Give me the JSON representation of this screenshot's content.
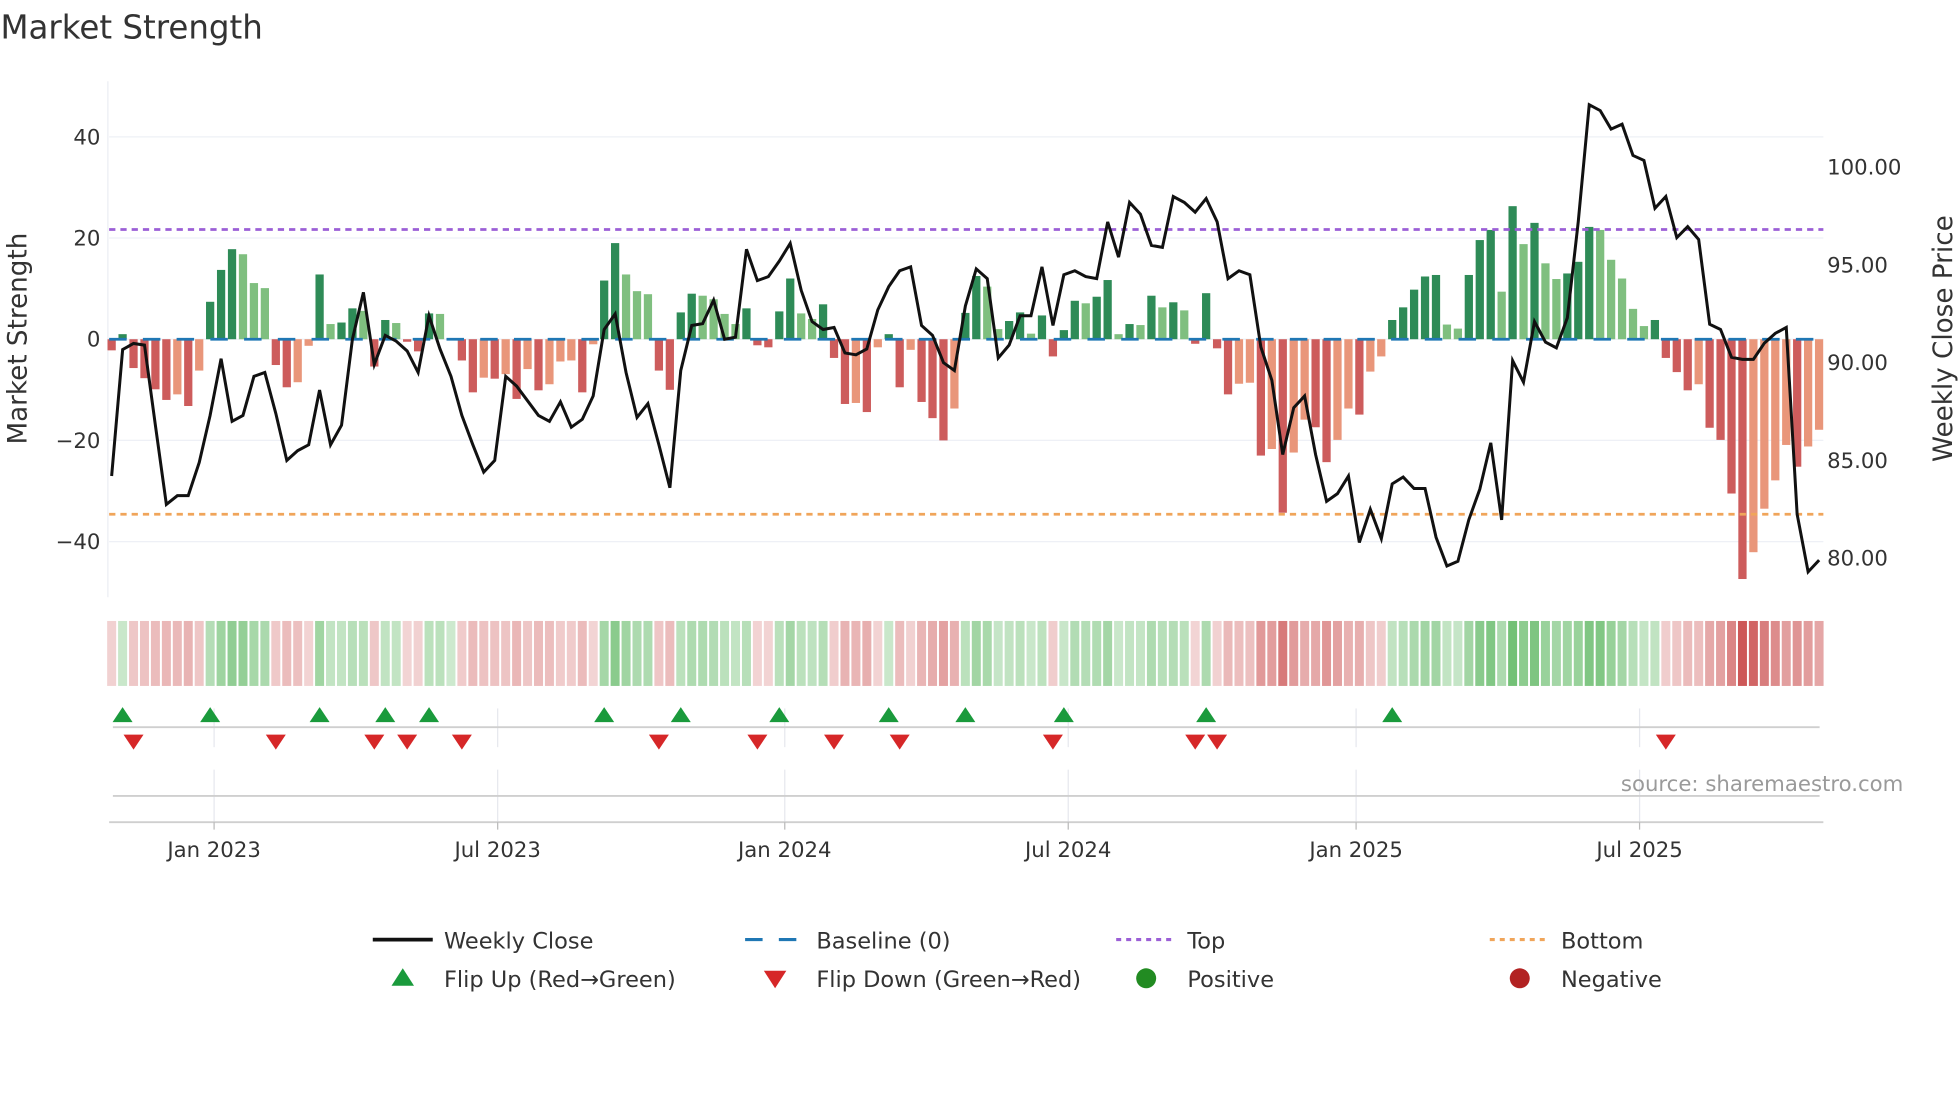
{
  "title": "Market Strength",
  "source_text": "source: sharemaestro.com",
  "colors": {
    "pos_strong": "#2e8b57",
    "pos_weak": "#7fbf7f",
    "neg_strong": "#cd5c5c",
    "neg_weak": "#e9967a",
    "baseline": "#1f77b4",
    "top": "#9b5fd6",
    "bottom": "#f0a55a",
    "line": "#111111",
    "flip_up": "#1a9a3c",
    "flip_down": "#d62728",
    "positive": "#228b22",
    "negative": "#b22222"
  },
  "chart_data": {
    "type": "bar",
    "title": "Market Strength",
    "ylabel": "Market Strength",
    "y2label": "Weekly Close Price",
    "ylim": [
      -51,
      51
    ],
    "y2lim": [
      78.0,
      104.4
    ],
    "yticks": [
      {
        "value": 40,
        "label": "40"
      },
      {
        "value": 20,
        "label": "20"
      },
      {
        "value": 0,
        "label": "0"
      },
      {
        "value": -20,
        "label": "−20"
      },
      {
        "value": -40,
        "label": "−40"
      }
    ],
    "y2ticks": [
      {
        "value": 100,
        "label": "100.00"
      },
      {
        "value": 95,
        "label": "95.00"
      },
      {
        "value": 90,
        "label": "90.00"
      },
      {
        "value": 85,
        "label": "85.00"
      },
      {
        "value": 80,
        "label": "80.00"
      }
    ],
    "xticks": [
      {
        "week": 9.36,
        "label": "Jan 2023"
      },
      {
        "week": 35.27,
        "label": "Jul 2023"
      },
      {
        "week": 61.5,
        "label": "Jan 2024"
      },
      {
        "week": 87.4,
        "label": "Jul 2024"
      },
      {
        "week": 113.7,
        "label": "Jan 2025"
      },
      {
        "week": 139.6,
        "label": "Jul 2025"
      }
    ],
    "top_level": 21.7,
    "bottom_level": -34.6,
    "baseline": 0,
    "strength": [
      -2.2,
      1,
      -5.7,
      -7.7,
      -9.9,
      -12,
      -10.9,
      -13.2,
      -6.2,
      7.4,
      13.7,
      17.8,
      16.8,
      11.1,
      10.1,
      -5.1,
      -9.5,
      -8.5,
      -1.3,
      12.8,
      3,
      3.3,
      6.1,
      5.6,
      -5.4,
      3.8,
      3.2,
      -0.5,
      -2.4,
      5.1,
      5,
      0,
      -4.2,
      -10.5,
      -7.6,
      -7.8,
      -6.9,
      -11.8,
      -5.9,
      -10.1,
      -8.9,
      -4.4,
      -4.2,
      -10.5,
      -1,
      11.6,
      19,
      12.8,
      9.5,
      8.9,
      -6.2,
      -10,
      5.3,
      9,
      8.6,
      7.9,
      5,
      3,
      6.1,
      -1.2,
      -1.6,
      5.5,
      12,
      5.1,
      4,
      6.9,
      -3.7,
      -12.8,
      -12.6,
      -14.4,
      -1.6,
      1,
      -9.5,
      -2.1,
      -12.4,
      -15.6,
      -20,
      -13.7,
      5.2,
      12.5,
      10.4,
      2,
      3.6,
      5.3,
      1.1,
      4.7,
      -3.4,
      1.8,
      7.6,
      7.1,
      8.4,
      11.7,
      1,
      3,
      2.8,
      8.6,
      6.3,
      7.3,
      5.7,
      -0.9,
      9.1,
      -1.8,
      -10.9,
      -8.8,
      -8.6,
      -23,
      -21.7,
      -34.3,
      -22.4,
      -15.9,
      -17.4,
      -24.3,
      -19.9,
      -13.7,
      -14.9,
      -6.4,
      -3.4,
      3.8,
      6.3,
      9.8,
      12.4,
      12.7,
      2.9,
      2.1,
      12.7,
      19.6,
      21.6,
      9.4,
      26.3,
      18.8,
      23,
      15,
      11.9,
      13,
      15.3,
      22.2,
      21.6,
      15.7,
      12,
      6,
      2.6,
      3.8,
      -3.7,
      -6.5,
      -10.1,
      -8.9,
      -17.5,
      -19.9,
      -30.5,
      -47.4,
      -42.1,
      -33.5,
      -27.9,
      -20.9,
      -25.2,
      -21.2,
      -17.9
    ],
    "weekly_close": [
      84.2,
      90.67,
      90.98,
      90.9,
      86.8,
      82.75,
      83.2,
      83.2,
      84.9,
      87.3,
      90.2,
      87.0,
      87.3,
      89.3,
      89.5,
      87.4,
      85.0,
      85.5,
      85.8,
      88.6,
      85.8,
      86.8,
      91.2,
      93.6,
      89.9,
      91.4,
      91.1,
      90.6,
      89.5,
      92.4,
      90.7,
      89.3,
      87.3,
      85.8,
      84.4,
      85.0,
      89.3,
      88.8,
      88.05,
      87.3,
      87.0,
      88.0,
      86.7,
      87.1,
      88.3,
      91.7,
      92.5,
      89.5,
      87.2,
      87.9,
      85.8,
      83.6,
      89.6,
      91.9,
      92.0,
      93.2,
      91.2,
      91.3,
      95.8,
      94.2,
      94.4,
      95.2,
      96.1,
      93.7,
      92.1,
      91.7,
      91.8,
      90.5,
      90.4,
      90.7,
      92.7,
      93.9,
      94.7,
      94.9,
      91.9,
      91.4,
      90.0,
      89.6,
      92.9,
      94.8,
      94.3,
      90.24,
      90.9,
      92.4,
      92.4,
      94.9,
      91.9,
      94.5,
      94.7,
      94.4,
      94.3,
      97.2,
      95.4,
      98.2,
      97.6,
      96.0,
      95.9,
      98.5,
      98.2,
      97.7,
      98.4,
      97.2,
      94.3,
      94.7,
      94.5,
      90.8,
      89.1,
      85.3,
      87.7,
      88.3,
      85.3,
      82.9,
      83.3,
      84.2,
      80.8,
      82.5,
      81.0,
      83.8,
      84.15,
      83.56,
      83.56,
      81.07,
      79.6,
      79.84,
      81.96,
      83.52,
      85.9,
      81.96,
      90.1,
      89.0,
      92.1,
      91.05,
      90.76,
      92.3,
      97.2,
      103.2,
      102.9,
      101.95,
      102.2,
      100.6,
      100.35,
      97.9,
      98.5,
      96.4,
      96.96,
      96.3,
      91.97,
      91.7,
      90.27,
      90.17,
      90.17,
      91.0,
      91.5,
      91.8,
      82.25,
      79.3,
      79.9
    ],
    "legend": {
      "placement": "bottom-center",
      "items": [
        {
          "key": "line",
          "label": "Weekly Close"
        },
        {
          "key": "baseline",
          "label": "Baseline (0)"
        },
        {
          "key": "top",
          "label": "Top"
        },
        {
          "key": "bottom",
          "label": "Bottom"
        },
        {
          "key": "flip_up",
          "label": "Flip Up (Red→Green)"
        },
        {
          "key": "flip_down",
          "label": "Flip Down (Green→Red)"
        },
        {
          "key": "positive",
          "label": "Positive"
        },
        {
          "key": "negative",
          "label": "Negative"
        }
      ]
    }
  }
}
